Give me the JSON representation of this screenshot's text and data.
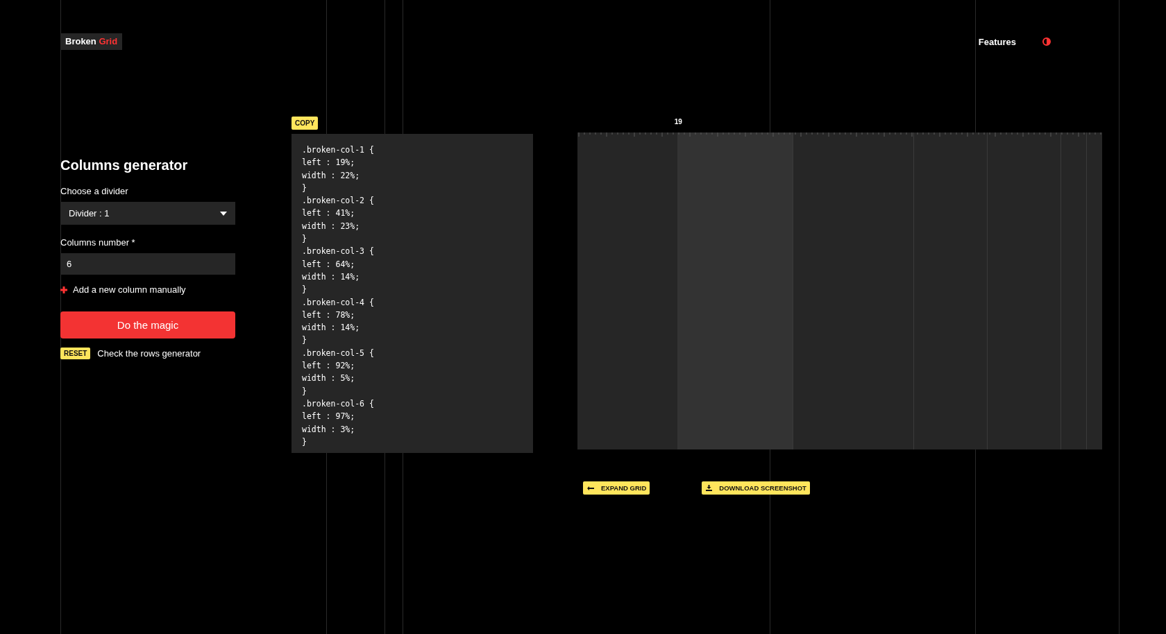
{
  "logo": {
    "word_1": "Broken",
    "word_2": "Grid"
  },
  "nav": {
    "features": "Features"
  },
  "generator": {
    "title": "Columns generator",
    "divider_label": "Choose a divider",
    "divider_value": "Divider : 1",
    "columns_label": "Columns number *",
    "columns_value": "6",
    "add_column": "Add a new column manually",
    "submit": "Do the magic",
    "reset": "RESET",
    "rows_link": "Check the rows generator"
  },
  "code": {
    "copy": "COPY"
  },
  "css_rules": [
    {
      "open": ".broken-col-1 {",
      "left": "left : 19%;",
      "width": "width : 22%;",
      "close": "}",
      "selected": true
    },
    {
      "open": ".broken-col-2 {",
      "left": "left : 41%;",
      "width": "width : 23%;",
      "close": "}",
      "selected": false
    },
    {
      "open": ".broken-col-3 {",
      "left": "left : 64%;",
      "width": "width : 14%;",
      "close": "}",
      "selected": false
    },
    {
      "open": ".broken-col-4 {",
      "left": "left : 78%;",
      "width": "width : 14%;",
      "close": "}",
      "selected": false
    },
    {
      "open": ".broken-col-5 {",
      "left": "left : 92%;",
      "width": "width : 5%;",
      "close": "}",
      "selected": false
    },
    {
      "open": ".broken-col-6 {",
      "left": "left : 97%;",
      "width": "width : 3%;",
      "close": "}",
      "selected": false
    }
  ],
  "preview": {
    "marker": "19",
    "expand": "EXPAND GRID",
    "download": "DOWNLOAD SCREENSHOT"
  }
}
